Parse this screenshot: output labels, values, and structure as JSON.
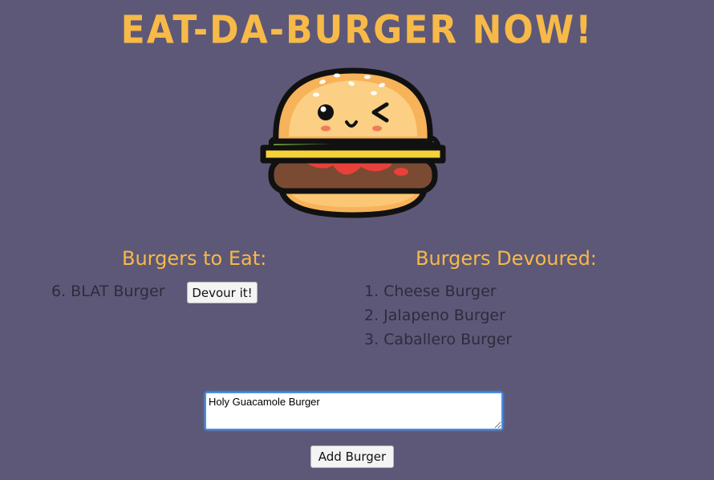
{
  "header": {
    "title": "Eat-Da-Burger Now!",
    "logo_icon": "winking-burger-icon"
  },
  "to_eat": {
    "heading": "Burgers to Eat:",
    "items": [
      {
        "label": "6. BLAT Burger",
        "button_label": "Devour it!"
      }
    ]
  },
  "devoured": {
    "heading": "Burgers Devoured:",
    "items": [
      {
        "label": "1. Cheese Burger"
      },
      {
        "label": "2. Jalapeno Burger"
      },
      {
        "label": "3. Caballero Burger"
      }
    ]
  },
  "form": {
    "input_value": "Holy Guacamole Burger",
    "submit_label": "Add Burger"
  },
  "colors": {
    "background": "#5d5878",
    "accent": "#f7b948",
    "list_text": "#2e2b3d",
    "input_focus": "#4a90e2"
  }
}
